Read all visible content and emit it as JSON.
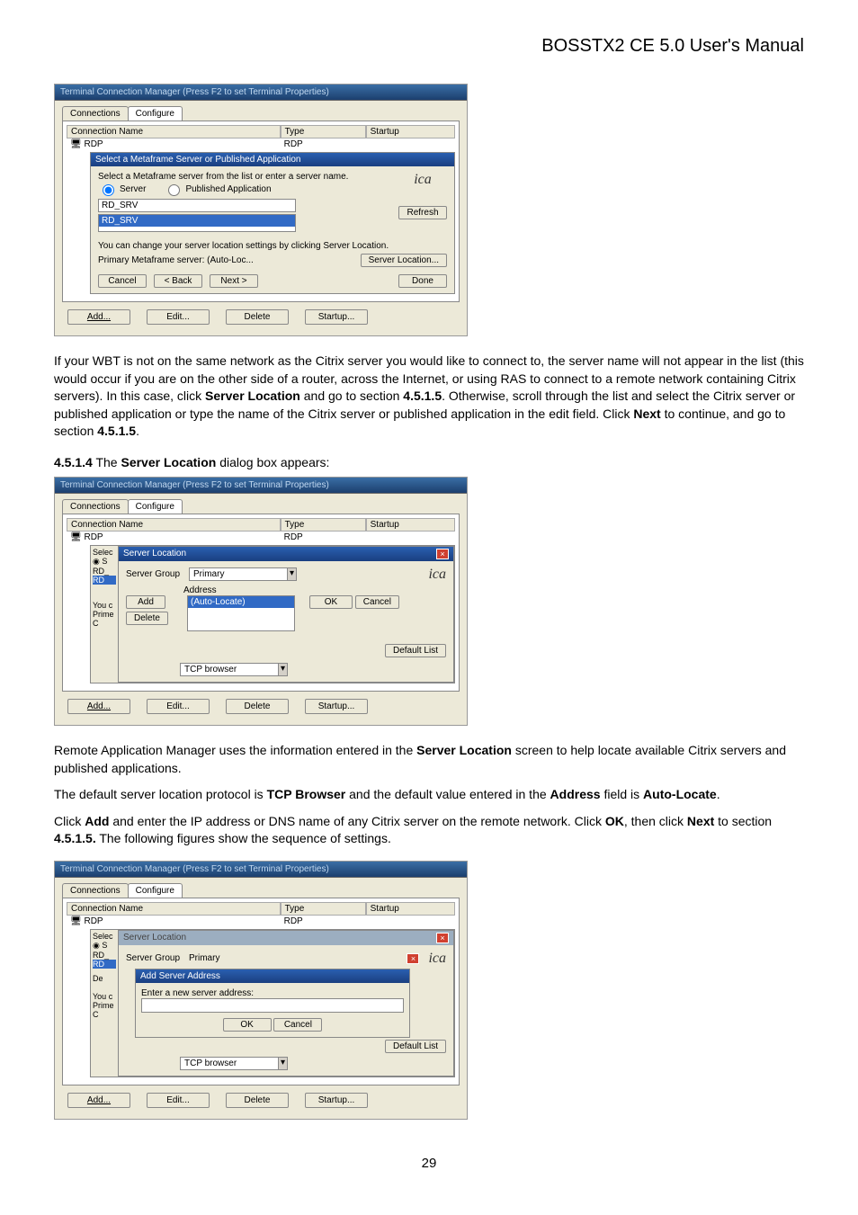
{
  "header": {
    "title": "BOSSTX2 CE 5.0 User's Manual"
  },
  "pageNumber": "29",
  "screenshot1": {
    "titlebar": "Terminal Connection Manager (Press F2 to set Terminal Properties)",
    "tabs": {
      "connections": "Connections",
      "configure": "Configure"
    },
    "listHeader": {
      "name": "Connection Name",
      "type": "Type",
      "startup": "Startup"
    },
    "listRow": {
      "name": "RDP",
      "type": "RDP"
    },
    "innerTitle": "Select a Metaframe Server or Published Application",
    "innerHint": "Select a Metaframe server from the list or enter a server name.",
    "radioServer": "Server",
    "radioPublished": "Published Application",
    "serverFieldValue": "RD_SRV",
    "listboxSelected": "RD_SRV",
    "refreshBtn": "Refresh",
    "hint2": "You can change your server location settings by clicking Server Location.",
    "hint3": "Primary Metaframe server: (Auto-Loc...",
    "serverLocationBtn": "Server Location...",
    "cancel": "Cancel",
    "back": "< Back",
    "next": "Next >",
    "done": "Done",
    "bottom": {
      "add": "Add...",
      "edit": "Edit...",
      "delete": "Delete",
      "startup": "Startup..."
    },
    "icaLabel": "ica"
  },
  "para1": {
    "p1a": "If your WBT is not on the same network as the Citrix server you would like to connect to, the server name will not appear in the list (this would occur if you are on the other side of a router, across the Internet, or using RAS to connect to a remote network containing Citrix servers). In this case, click ",
    "b1": "Server Location",
    "p1b": " and go to section ",
    "b2": "4.5.1.5",
    "p1c": ". Otherwise, scroll through the list and select the Citrix server or published application or type the name of the Citrix server or published application in the edit field. Click ",
    "b3": "Next",
    "p1d": " to continue, and go to section ",
    "b4": "4.5.1.5",
    "p1e": "."
  },
  "heading2": {
    "num": "4.5.1.4",
    "pre": "  The ",
    "bold": "Server Location",
    "post": " dialog box appears:"
  },
  "screenshot2": {
    "innerTitle": "Server Location",
    "labelServerGroup": "Server Group",
    "valueServerGroup": "Primary",
    "labelAddress": "Address",
    "valueAddress": "(Auto-Locate)",
    "addBtn": "Add",
    "deleteBtn": "Delete",
    "okBtn": "OK",
    "cancelBtn": "Cancel",
    "defaultListBtn": "Default List",
    "tcpBrowser": "TCP browser",
    "sideYou": "You c",
    "sidePrime": "Prime",
    "sideC": "C"
  },
  "para2": {
    "p1a": "Remote Application Manager uses the information entered in the ",
    "b1": "Server Location",
    "p1b": " screen to help locate available Citrix servers and published applications."
  },
  "para3": {
    "p1a": "The default server location protocol is ",
    "b1": "TCP Browser",
    "p1b": " and the default value entered in the ",
    "b2": "Address",
    "p1c": " field is ",
    "b3": "Auto-Locate",
    "p1d": "."
  },
  "para4": {
    "p1a": "Click ",
    "b1": "Add",
    "p1b": " and enter the IP address or DNS name of any Citrix server on the remote network. Click ",
    "b2": "OK",
    "p1c": ", then click ",
    "b3": "Next",
    "p1d": " to section ",
    "b4": "4.5.1.5.",
    "p1e": " The following figures show the sequence of settings."
  },
  "screenshot3": {
    "innerTitle": "Server Location",
    "addServerTitle": "Add Server Address",
    "addServerLabel": "Enter a new server address:",
    "okBtn": "OK",
    "cancelBtn": "Cancel",
    "labelServerGroup": "Server Group",
    "valueServerGroup": "Primary"
  }
}
